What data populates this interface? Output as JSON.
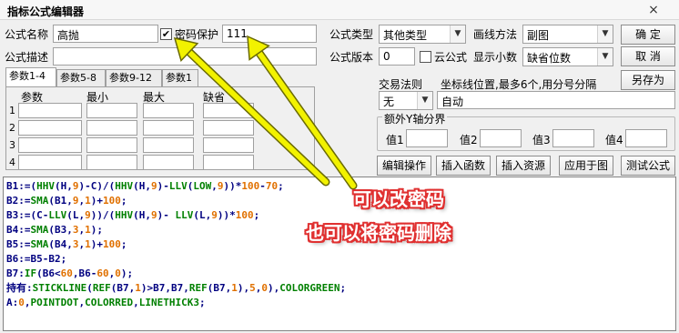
{
  "window": {
    "title": "指标公式编辑器",
    "close_glyph": "×"
  },
  "form": {
    "name_label": "公式名称",
    "name_value": "高抛",
    "password_check": "✔",
    "password_label": "密码保护",
    "password_value": "111",
    "desc_label": "公式描述",
    "desc_value": "",
    "type_label": "公式类型",
    "type_value": "其他类型",
    "draw_label": "画线方法",
    "draw_value": "副图",
    "version_label": "公式版本",
    "version_value": "0",
    "cloud_label": "云公式",
    "decimal_label": "显示小数",
    "decimal_value": "缺省位数",
    "trade_label": "交易法则",
    "trade_value": "无",
    "coord_label": "坐标线位置,最多6个,用分号分隔",
    "coord_value": "自动",
    "extra_y_label": "额外Y轴分界",
    "y_labels": [
      "值1",
      "值2",
      "值3",
      "值4"
    ],
    "dropdown_arrow": "▼"
  },
  "buttons": {
    "ok": "确  定",
    "cancel": "取  消",
    "save_as": "另存为",
    "edit_op": "编辑操作",
    "insert_func": "插入函数",
    "insert_res": "插入资源",
    "apply_chart": "应用于图",
    "test_formula": "测试公式"
  },
  "tabs": [
    "参数1-4",
    "参数5-8",
    "参数9-12",
    "参数1"
  ],
  "param_headers": [
    "参数",
    "最小",
    "最大",
    "缺省"
  ],
  "param_rows": [
    "1",
    "2",
    "3",
    "4"
  ],
  "code_lines": [
    [
      {
        "t": "B1:=(",
        "c": "#000080"
      },
      {
        "t": "HHV",
        "c": "#008000"
      },
      {
        "t": "(",
        "c": "#000080"
      },
      {
        "t": "H",
        "c": "#000080"
      },
      {
        "t": ",",
        "c": "#000080"
      },
      {
        "t": "9",
        "c": "#e07000"
      },
      {
        "t": ")-C)/(",
        "c": "#000080"
      },
      {
        "t": "HHV",
        "c": "#008000"
      },
      {
        "t": "(H,",
        "c": "#000080"
      },
      {
        "t": "9",
        "c": "#e07000"
      },
      {
        "t": ")-",
        "c": "#000080"
      },
      {
        "t": "LLV",
        "c": "#008000"
      },
      {
        "t": "(",
        "c": "#000080"
      },
      {
        "t": "LOW",
        "c": "#008000"
      },
      {
        "t": ",",
        "c": "#000080"
      },
      {
        "t": "9",
        "c": "#e07000"
      },
      {
        "t": "))*",
        "c": "#000080"
      },
      {
        "t": "100",
        "c": "#e07000"
      },
      {
        "t": "-",
        "c": "#000080"
      },
      {
        "t": "70",
        "c": "#e07000"
      },
      {
        "t": ";",
        "c": "#000080"
      }
    ],
    [
      {
        "t": "B2:=",
        "c": "#000080"
      },
      {
        "t": "SMA",
        "c": "#008000"
      },
      {
        "t": "(B1,",
        "c": "#000080"
      },
      {
        "t": "9",
        "c": "#e07000"
      },
      {
        "t": ",",
        "c": "#000080"
      },
      {
        "t": "1",
        "c": "#e07000"
      },
      {
        "t": ")+",
        "c": "#000080"
      },
      {
        "t": "100",
        "c": "#e07000"
      },
      {
        "t": ";",
        "c": "#000080"
      }
    ],
    [
      {
        "t": "B3:=(C-",
        "c": "#000080"
      },
      {
        "t": "LLV",
        "c": "#008000"
      },
      {
        "t": "(L,",
        "c": "#000080"
      },
      {
        "t": "9",
        "c": "#e07000"
      },
      {
        "t": "))/(",
        "c": "#000080"
      },
      {
        "t": "HHV",
        "c": "#008000"
      },
      {
        "t": "(H,",
        "c": "#000080"
      },
      {
        "t": "9",
        "c": "#e07000"
      },
      {
        "t": ")- ",
        "c": "#000080"
      },
      {
        "t": "LLV",
        "c": "#008000"
      },
      {
        "t": "(L,",
        "c": "#000080"
      },
      {
        "t": "9",
        "c": "#e07000"
      },
      {
        "t": "))*",
        "c": "#000080"
      },
      {
        "t": "100",
        "c": "#e07000"
      },
      {
        "t": ";",
        "c": "#000080"
      }
    ],
    [
      {
        "t": "B4:=",
        "c": "#000080"
      },
      {
        "t": "SMA",
        "c": "#008000"
      },
      {
        "t": "(B3,",
        "c": "#000080"
      },
      {
        "t": "3",
        "c": "#e07000"
      },
      {
        "t": ",",
        "c": "#000080"
      },
      {
        "t": "1",
        "c": "#e07000"
      },
      {
        "t": ");",
        "c": "#000080"
      }
    ],
    [
      {
        "t": "B5:=",
        "c": "#000080"
      },
      {
        "t": "SMA",
        "c": "#008000"
      },
      {
        "t": "(B4,",
        "c": "#000080"
      },
      {
        "t": "3",
        "c": "#e07000"
      },
      {
        "t": ",",
        "c": "#000080"
      },
      {
        "t": "1",
        "c": "#e07000"
      },
      {
        "t": ")+",
        "c": "#000080"
      },
      {
        "t": "100",
        "c": "#e07000"
      },
      {
        "t": ";",
        "c": "#000080"
      }
    ],
    [
      {
        "t": "B6:=B5-B2;",
        "c": "#000080"
      }
    ],
    [
      {
        "t": "B7:",
        "c": "#000080"
      },
      {
        "t": "IF",
        "c": "#008000"
      },
      {
        "t": "(B6<",
        "c": "#000080"
      },
      {
        "t": "60",
        "c": "#e07000"
      },
      {
        "t": ",B6-",
        "c": "#000080"
      },
      {
        "t": "60",
        "c": "#e07000"
      },
      {
        "t": ",",
        "c": "#000080"
      },
      {
        "t": "0",
        "c": "#e07000"
      },
      {
        "t": ");",
        "c": "#000080"
      }
    ],
    [
      {
        "t": "持有:",
        "c": "#000080"
      },
      {
        "t": "STICKLINE",
        "c": "#008000"
      },
      {
        "t": "(",
        "c": "#000080"
      },
      {
        "t": "REF",
        "c": "#008000"
      },
      {
        "t": "(B7,",
        "c": "#000080"
      },
      {
        "t": "1",
        "c": "#e07000"
      },
      {
        "t": ")>B7,B7,",
        "c": "#000080"
      },
      {
        "t": "REF",
        "c": "#008000"
      },
      {
        "t": "(B7,",
        "c": "#000080"
      },
      {
        "t": "1",
        "c": "#e07000"
      },
      {
        "t": "),",
        "c": "#000080"
      },
      {
        "t": "5",
        "c": "#e07000"
      },
      {
        "t": ",",
        "c": "#000080"
      },
      {
        "t": "0",
        "c": "#e07000"
      },
      {
        "t": "),",
        "c": "#000080"
      },
      {
        "t": "COLORGREEN",
        "c": "#008000"
      },
      {
        "t": ";",
        "c": "#000080"
      }
    ],
    [
      {
        "t": "A:",
        "c": "#000080"
      },
      {
        "t": "0",
        "c": "#e07000"
      },
      {
        "t": ",",
        "c": "#000080"
      },
      {
        "t": "POINTDOT",
        "c": "#008000"
      },
      {
        "t": ",",
        "c": "#000080"
      },
      {
        "t": "COLORRED",
        "c": "#008000"
      },
      {
        "t": ",",
        "c": "#000080"
      },
      {
        "t": "LINETHICK3",
        "c": "#008000"
      },
      {
        "t": ";",
        "c": "#000080"
      }
    ]
  ],
  "annotation": {
    "line1": "可以改密码",
    "line2": "也可以将密码删除",
    "arrow_color": "#f2f200"
  }
}
